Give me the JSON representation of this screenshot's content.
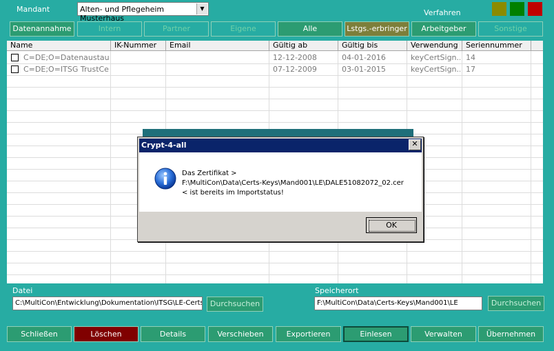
{
  "top": {
    "mandant_label": "Mandant",
    "mandant_value": "Alten- und Pflegeheim Musterhaus",
    "verfahren_label": "Verfahren",
    "status_colors": [
      "#8b8b00",
      "#008000",
      "#c00000"
    ]
  },
  "tabs": [
    {
      "label": "Datenannahme"
    },
    {
      "label": "Intern"
    },
    {
      "label": "Partner"
    },
    {
      "label": "Eigene"
    },
    {
      "label": "Alle"
    },
    {
      "label": "Lstgs.-erbringer"
    },
    {
      "label": "Arbeitgeber"
    },
    {
      "label": "Sonstige"
    }
  ],
  "grid": {
    "columns": [
      "Name",
      "IK-Nummer",
      "Email",
      "Gültig ab",
      "Gültig bis",
      "Verwendung",
      "Seriennummer"
    ],
    "rows": [
      {
        "name": "C=DE;O=Datenaustaus...",
        "ik": "",
        "email": "",
        "valid_from": "12-12-2008",
        "valid_to": "04-01-2016",
        "usage": "keyCertSign...",
        "serial": "14"
      },
      {
        "name": "C=DE;O=ITSG TrustCe...",
        "ik": "",
        "email": "",
        "valid_from": "07-12-2009",
        "valid_to": "03-01-2015",
        "usage": "keyCertSign...",
        "serial": "17"
      }
    ]
  },
  "dialog": {
    "title": "Crypt-4-all",
    "line1": "Das Zertifikat >",
    "line2": "F:\\MultiCon\\Data\\Certs-Keys\\Mand001\\LE\\DALE51082072_02.cer",
    "line3": "< ist bereits im Importstatus!",
    "ok_label": "OK",
    "close_glyph": "✕"
  },
  "files": {
    "datei_label": "Datei",
    "datei_value": "C:\\MultiCon\\Entwicklung\\Dokumentation\\ITSG\\LE-Certs",
    "browse1": "Durchsuchen",
    "speicherort_label": "Speicherort",
    "speicherort_value": "F:\\MultiCon\\Data\\Certs-Keys\\Mand001\\LE",
    "browse2": "Durchsuchen"
  },
  "bottom": [
    {
      "label": "Schließen"
    },
    {
      "label": "Löschen"
    },
    {
      "label": "Details"
    },
    {
      "label": "Verschieben"
    },
    {
      "label": "Exportieren"
    },
    {
      "label": "Einlesen"
    },
    {
      "label": "Verwalten"
    },
    {
      "label": "Übernehmen"
    }
  ]
}
